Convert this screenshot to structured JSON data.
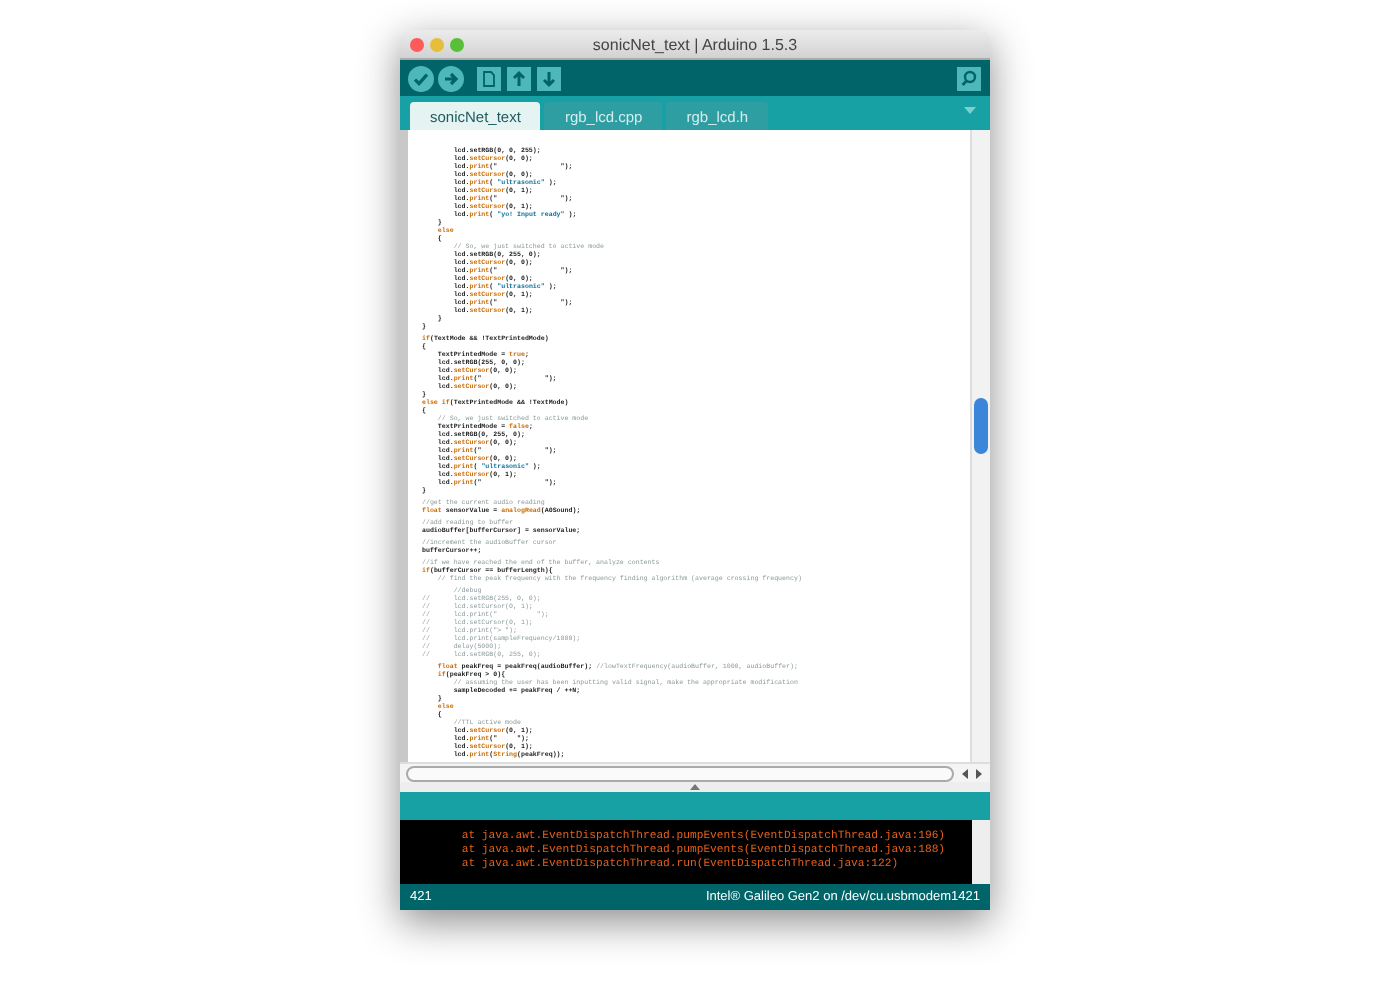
{
  "window": {
    "title": "sonicNet_text | Arduino 1.5.3"
  },
  "tabs": [
    {
      "label": "sonicNet_text",
      "selected": true
    },
    {
      "label": "rgb_lcd.cpp",
      "selected": false
    },
    {
      "label": "rgb_lcd.h",
      "selected": false
    }
  ],
  "editor": {
    "lines": [
      {
        "gap_before": false,
        "parts": [
          {
            "kind": "txt",
            "text": "        lcd.setRGB(0, 0, 255);"
          }
        ]
      },
      {
        "gap_before": false,
        "parts": [
          {
            "kind": "txt",
            "text": "        lcd."
          },
          {
            "kind": "fn",
            "text": "setCursor"
          },
          {
            "kind": "txt",
            "text": "(0, 0);"
          }
        ]
      },
      {
        "gap_before": false,
        "parts": [
          {
            "kind": "txt",
            "text": "        lcd."
          },
          {
            "kind": "fn",
            "text": "print"
          },
          {
            "kind": "txt",
            "text": "(\"                \");"
          }
        ]
      },
      {
        "gap_before": false,
        "parts": [
          {
            "kind": "txt",
            "text": "        lcd."
          },
          {
            "kind": "fn",
            "text": "setCursor"
          },
          {
            "kind": "txt",
            "text": "(0, 0);"
          }
        ]
      },
      {
        "gap_before": false,
        "parts": [
          {
            "kind": "txt",
            "text": "        lcd."
          },
          {
            "kind": "fn",
            "text": "print"
          },
          {
            "kind": "txt",
            "text": "( "
          },
          {
            "kind": "str",
            "text": "\"ultrasonic\""
          },
          {
            "kind": "txt",
            "text": " );"
          }
        ]
      },
      {
        "gap_before": false,
        "parts": [
          {
            "kind": "txt",
            "text": "        lcd."
          },
          {
            "kind": "fn",
            "text": "setCursor"
          },
          {
            "kind": "txt",
            "text": "(0, 1);"
          }
        ]
      },
      {
        "gap_before": false,
        "parts": [
          {
            "kind": "txt",
            "text": "        lcd."
          },
          {
            "kind": "fn",
            "text": "print"
          },
          {
            "kind": "txt",
            "text": "(\"                \");"
          }
        ]
      },
      {
        "gap_before": false,
        "parts": [
          {
            "kind": "txt",
            "text": "        lcd."
          },
          {
            "kind": "fn",
            "text": "setCursor"
          },
          {
            "kind": "txt",
            "text": "(0, 1);"
          }
        ]
      },
      {
        "gap_before": false,
        "parts": [
          {
            "kind": "txt",
            "text": "        lcd."
          },
          {
            "kind": "fn",
            "text": "print"
          },
          {
            "kind": "txt",
            "text": "( "
          },
          {
            "kind": "str",
            "text": "\"yo! Input ready\""
          },
          {
            "kind": "txt",
            "text": " );"
          }
        ]
      },
      {
        "gap_before": false,
        "parts": [
          {
            "kind": "txt",
            "text": "    }"
          }
        ]
      },
      {
        "gap_before": false,
        "parts": [
          {
            "kind": "fn",
            "text": "    else"
          }
        ]
      },
      {
        "gap_before": false,
        "parts": [
          {
            "kind": "txt",
            "text": "    {"
          }
        ]
      },
      {
        "gap_before": false,
        "parts": [
          {
            "kind": "cmt",
            "text": "        // So, we just switched to active mode"
          }
        ]
      },
      {
        "gap_before": false,
        "parts": [
          {
            "kind": "txt",
            "text": "        lcd.setRGB(0, 255, 0);"
          }
        ]
      },
      {
        "gap_before": false,
        "parts": [
          {
            "kind": "txt",
            "text": "        lcd."
          },
          {
            "kind": "fn",
            "text": "setCursor"
          },
          {
            "kind": "txt",
            "text": "(0, 0);"
          }
        ]
      },
      {
        "gap_before": false,
        "parts": [
          {
            "kind": "txt",
            "text": "        lcd."
          },
          {
            "kind": "fn",
            "text": "print"
          },
          {
            "kind": "txt",
            "text": "(\"                \");"
          }
        ]
      },
      {
        "gap_before": false,
        "parts": [
          {
            "kind": "txt",
            "text": "        lcd."
          },
          {
            "kind": "fn",
            "text": "setCursor"
          },
          {
            "kind": "txt",
            "text": "(0, 0);"
          }
        ]
      },
      {
        "gap_before": false,
        "parts": [
          {
            "kind": "txt",
            "text": "        lcd."
          },
          {
            "kind": "fn",
            "text": "print"
          },
          {
            "kind": "txt",
            "text": "( "
          },
          {
            "kind": "str",
            "text": "\"ultrasonic\""
          },
          {
            "kind": "txt",
            "text": " );"
          }
        ]
      },
      {
        "gap_before": false,
        "parts": [
          {
            "kind": "txt",
            "text": "        lcd."
          },
          {
            "kind": "fn",
            "text": "setCursor"
          },
          {
            "kind": "txt",
            "text": "(0, 1);"
          }
        ]
      },
      {
        "gap_before": false,
        "parts": [
          {
            "kind": "txt",
            "text": "        lcd."
          },
          {
            "kind": "fn",
            "text": "print"
          },
          {
            "kind": "txt",
            "text": "(\"                \");"
          }
        ]
      },
      {
        "gap_before": false,
        "parts": [
          {
            "kind": "txt",
            "text": "        lcd."
          },
          {
            "kind": "fn",
            "text": "setCursor"
          },
          {
            "kind": "txt",
            "text": "(0, 1);"
          }
        ]
      },
      {
        "gap_before": false,
        "parts": [
          {
            "kind": "txt",
            "text": "    }"
          }
        ]
      },
      {
        "gap_before": false,
        "parts": [
          {
            "kind": "txt",
            "text": "}"
          }
        ]
      },
      {
        "gap_before": true,
        "parts": [
          {
            "kind": "fn",
            "text": "if"
          },
          {
            "kind": "txt",
            "text": "(TextMode && !TextPrintedMode)"
          }
        ]
      },
      {
        "gap_before": false,
        "parts": [
          {
            "kind": "txt",
            "text": "{"
          }
        ]
      },
      {
        "gap_before": false,
        "parts": [
          {
            "kind": "txt",
            "text": "    TextPrintedMode = "
          },
          {
            "kind": "fn",
            "text": "true"
          },
          {
            "kind": "txt",
            "text": ";"
          }
        ]
      },
      {
        "gap_before": false,
        "parts": [
          {
            "kind": "txt",
            "text": "    lcd.setRGB(255, 0, 0);"
          }
        ]
      },
      {
        "gap_before": false,
        "parts": [
          {
            "kind": "txt",
            "text": "    lcd."
          },
          {
            "kind": "fn",
            "text": "setCursor"
          },
          {
            "kind": "txt",
            "text": "(0, 0);"
          }
        ]
      },
      {
        "gap_before": false,
        "parts": [
          {
            "kind": "txt",
            "text": "    lcd."
          },
          {
            "kind": "fn",
            "text": "print"
          },
          {
            "kind": "txt",
            "text": "(\"                \");"
          }
        ]
      },
      {
        "gap_before": false,
        "parts": [
          {
            "kind": "txt",
            "text": "    lcd."
          },
          {
            "kind": "fn",
            "text": "setCursor"
          },
          {
            "kind": "txt",
            "text": "(0, 0);"
          }
        ]
      },
      {
        "gap_before": false,
        "parts": [
          {
            "kind": "txt",
            "text": "}"
          }
        ]
      },
      {
        "gap_before": false,
        "parts": [
          {
            "kind": "fn",
            "text": "else if"
          },
          {
            "kind": "txt",
            "text": "(TextPrintedMode && !TextMode)"
          }
        ]
      },
      {
        "gap_before": false,
        "parts": [
          {
            "kind": "txt",
            "text": "{"
          }
        ]
      },
      {
        "gap_before": false,
        "parts": [
          {
            "kind": "cmt",
            "text": "    // So, we just switched to active mode"
          }
        ]
      },
      {
        "gap_before": false,
        "parts": [
          {
            "kind": "txt",
            "text": "    TextPrintedMode = "
          },
          {
            "kind": "fn",
            "text": "false"
          },
          {
            "kind": "txt",
            "text": ";"
          }
        ]
      },
      {
        "gap_before": false,
        "parts": [
          {
            "kind": "txt",
            "text": "    lcd.setRGB(0, 255, 0);"
          }
        ]
      },
      {
        "gap_before": false,
        "parts": [
          {
            "kind": "txt",
            "text": "    lcd."
          },
          {
            "kind": "fn",
            "text": "setCursor"
          },
          {
            "kind": "txt",
            "text": "(0, 0);"
          }
        ]
      },
      {
        "gap_before": false,
        "parts": [
          {
            "kind": "txt",
            "text": "    lcd."
          },
          {
            "kind": "fn",
            "text": "print"
          },
          {
            "kind": "txt",
            "text": "(\"                \");"
          }
        ]
      },
      {
        "gap_before": false,
        "parts": [
          {
            "kind": "txt",
            "text": "    lcd."
          },
          {
            "kind": "fn",
            "text": "setCursor"
          },
          {
            "kind": "txt",
            "text": "(0, 0);"
          }
        ]
      },
      {
        "gap_before": false,
        "parts": [
          {
            "kind": "txt",
            "text": "    lcd."
          },
          {
            "kind": "fn",
            "text": "print"
          },
          {
            "kind": "txt",
            "text": "( "
          },
          {
            "kind": "str",
            "text": "\"ultrasonic\""
          },
          {
            "kind": "txt",
            "text": " );"
          }
        ]
      },
      {
        "gap_before": false,
        "parts": [
          {
            "kind": "txt",
            "text": "    lcd."
          },
          {
            "kind": "fn",
            "text": "setCursor"
          },
          {
            "kind": "txt",
            "text": "(0, 1);"
          }
        ]
      },
      {
        "gap_before": false,
        "parts": [
          {
            "kind": "txt",
            "text": "    lcd."
          },
          {
            "kind": "fn",
            "text": "print"
          },
          {
            "kind": "txt",
            "text": "(\"                \");"
          }
        ]
      },
      {
        "gap_before": false,
        "parts": [
          {
            "kind": "txt",
            "text": "}"
          }
        ]
      },
      {
        "gap_before": true,
        "parts": [
          {
            "kind": "cmt",
            "text": "//get the current audio reading"
          }
        ]
      },
      {
        "gap_before": false,
        "parts": [
          {
            "kind": "fn",
            "text": "float"
          },
          {
            "kind": "txt",
            "text": " sensorValue = "
          },
          {
            "kind": "fn",
            "text": "analogRead"
          },
          {
            "kind": "txt",
            "text": "(A0Sound);"
          }
        ]
      },
      {
        "gap_before": true,
        "parts": [
          {
            "kind": "cmt",
            "text": "//add reading to buffer"
          }
        ]
      },
      {
        "gap_before": false,
        "parts": [
          {
            "kind": "txt",
            "text": "audioBuffer[bufferCursor] = sensorValue;"
          }
        ]
      },
      {
        "gap_before": true,
        "parts": [
          {
            "kind": "cmt",
            "text": "//increment the audioBuffer cursor"
          }
        ]
      },
      {
        "gap_before": false,
        "parts": [
          {
            "kind": "txt",
            "text": "bufferCursor++;"
          }
        ]
      },
      {
        "gap_before": true,
        "parts": [
          {
            "kind": "cmt",
            "text": "//if we have reached the end of the buffer, analyze contents"
          }
        ]
      },
      {
        "gap_before": false,
        "parts": [
          {
            "kind": "fn",
            "text": "if"
          },
          {
            "kind": "txt",
            "text": "(bufferCursor == bufferLength){"
          }
        ]
      },
      {
        "gap_before": false,
        "parts": [
          {
            "kind": "cmt",
            "text": "    // find the peak frequency with the frequency finding algorithm (average crossing frequency)"
          }
        ]
      },
      {
        "gap_before": true,
        "parts": [
          {
            "kind": "cmt",
            "text": "        //debug"
          }
        ]
      },
      {
        "gap_before": false,
        "parts": [
          {
            "kind": "cmt",
            "text": "//      lcd.setRGB(255, 0, 0);"
          }
        ]
      },
      {
        "gap_before": false,
        "parts": [
          {
            "kind": "cmt",
            "text": "//      lcd.setCursor(0, 1);"
          }
        ]
      },
      {
        "gap_before": false,
        "parts": [
          {
            "kind": "cmt",
            "text": "//      lcd.print(\"          \");"
          }
        ]
      },
      {
        "gap_before": false,
        "parts": [
          {
            "kind": "cmt",
            "text": "//      lcd.setCursor(0, 1);"
          }
        ]
      },
      {
        "gap_before": false,
        "parts": [
          {
            "kind": "cmt",
            "text": "//      lcd.print(\"> \");"
          }
        ]
      },
      {
        "gap_before": false,
        "parts": [
          {
            "kind": "cmt",
            "text": "//      lcd.print(sampleFrequency/1000);"
          }
        ]
      },
      {
        "gap_before": false,
        "parts": [
          {
            "kind": "cmt",
            "text": "//      delay(5000);"
          }
        ]
      },
      {
        "gap_before": false,
        "parts": [
          {
            "kind": "cmt",
            "text": "//      lcd.setRGB(0, 255, 0);"
          }
        ]
      },
      {
        "gap_before": true,
        "parts": [
          {
            "kind": "fn",
            "text": "    float"
          },
          {
            "kind": "txt",
            "text": " peakFreq = peakFreq(audioBuffer); "
          },
          {
            "kind": "cmt",
            "text": "//lowTextFrequency(audioBuffer, 1000, audioBuffer);"
          }
        ]
      },
      {
        "gap_before": false,
        "parts": [
          {
            "kind": "fn",
            "text": "    if"
          },
          {
            "kind": "txt",
            "text": "(peakFreq > 0){"
          }
        ]
      },
      {
        "gap_before": false,
        "parts": [
          {
            "kind": "cmt",
            "text": "        // assuming the user has been inputting valid signal, make the appropriate modification"
          }
        ]
      },
      {
        "gap_before": false,
        "parts": [
          {
            "kind": "txt",
            "text": "        sampleDecoded += peakFreq / ++N;"
          }
        ]
      },
      {
        "gap_before": false,
        "parts": [
          {
            "kind": "txt",
            "text": "    }"
          }
        ]
      },
      {
        "gap_before": false,
        "parts": [
          {
            "kind": "fn",
            "text": "    else"
          }
        ]
      },
      {
        "gap_before": false,
        "parts": [
          {
            "kind": "txt",
            "text": "    {"
          }
        ]
      },
      {
        "gap_before": false,
        "parts": [
          {
            "kind": "cmt",
            "text": "        //TTL active mode"
          }
        ]
      },
      {
        "gap_before": false,
        "parts": [
          {
            "kind": "txt",
            "text": "        lcd."
          },
          {
            "kind": "fn",
            "text": "setCursor"
          },
          {
            "kind": "txt",
            "text": "(0, 1);"
          }
        ]
      },
      {
        "gap_before": false,
        "parts": [
          {
            "kind": "txt",
            "text": "        lcd."
          },
          {
            "kind": "fn",
            "text": "print"
          },
          {
            "kind": "txt",
            "text": "(\"     \");"
          }
        ]
      },
      {
        "gap_before": false,
        "parts": [
          {
            "kind": "txt",
            "text": "        lcd."
          },
          {
            "kind": "fn",
            "text": "setCursor"
          },
          {
            "kind": "txt",
            "text": "(0, 1);"
          }
        ]
      },
      {
        "gap_before": false,
        "parts": [
          {
            "kind": "txt",
            "text": "        lcd."
          },
          {
            "kind": "fn",
            "text": "print"
          },
          {
            "kind": "txt",
            "text": "("
          },
          {
            "kind": "fn",
            "text": "String"
          },
          {
            "kind": "txt",
            "text": "(peakFreq));"
          }
        ]
      }
    ]
  },
  "console": {
    "lines": [
      "        at java.awt.EventDispatchThread.pumpEvents(EventDispatchThread.java:196)",
      "        at java.awt.EventDispatchThread.pumpEvents(EventDispatchThread.java:188)",
      "        at java.awt.EventDispatchThread.run(EventDispatchThread.java:122)"
    ]
  },
  "status_bar": {
    "line": "421",
    "board": "Intel® Galileo Gen2 on /dev/cu.usbmodem1421"
  }
}
